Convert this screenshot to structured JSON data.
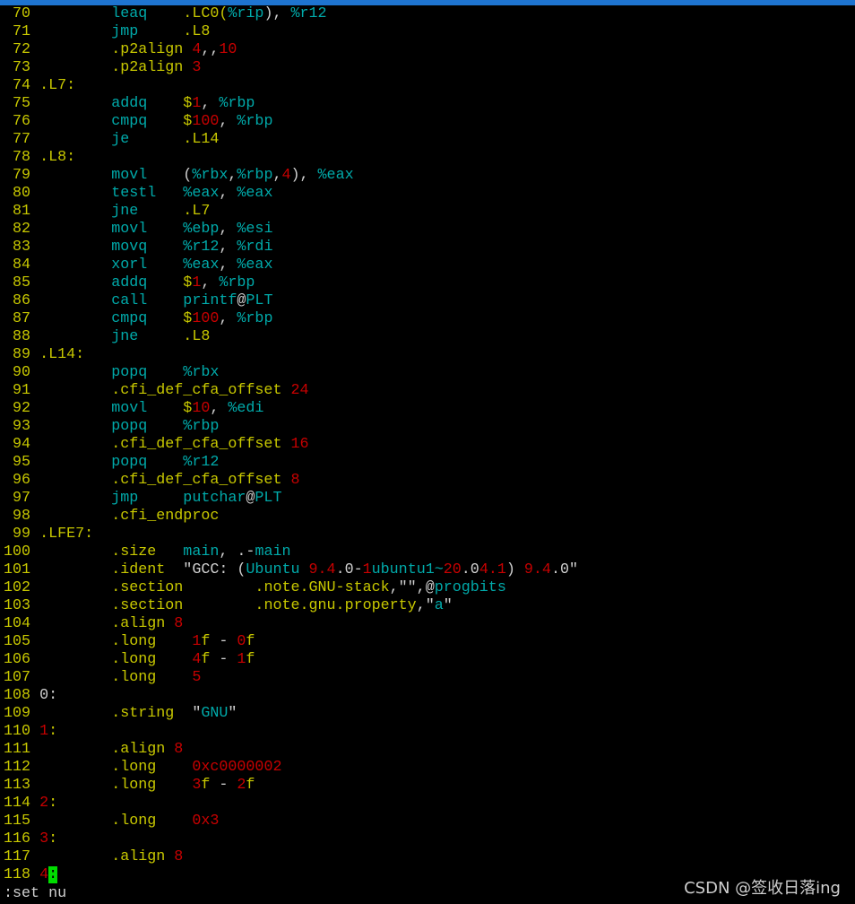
{
  "colors": {
    "line_number": "#c8c800",
    "label": "#c8c800",
    "mnemonic": "#00aaaa",
    "directive": "#c8c800",
    "number": "#c80000",
    "plain": "#d0d0d0",
    "cursor": "#00dd00",
    "title_bar": "#1e74d0"
  },
  "lines": [
    {
      "n": "70",
      "segs": [
        [
          "        ",
          "p"
        ],
        [
          "leaq",
          "k"
        ],
        [
          "    .LC0(",
          "d"
        ],
        [
          "%rip",
          "k"
        ],
        [
          "), ",
          "p"
        ],
        [
          "%r12",
          "k"
        ]
      ]
    },
    {
      "n": "71",
      "segs": [
        [
          "        ",
          "p"
        ],
        [
          "jmp",
          "k"
        ],
        [
          "     .L8",
          "d"
        ]
      ]
    },
    {
      "n": "72",
      "segs": [
        [
          "        ",
          "p"
        ],
        [
          ".p2align ",
          "d"
        ],
        [
          "4",
          "r"
        ],
        [
          ",,",
          "p"
        ],
        [
          "10",
          "r"
        ]
      ]
    },
    {
      "n": "73",
      "segs": [
        [
          "        ",
          "p"
        ],
        [
          ".p2align ",
          "d"
        ],
        [
          "3",
          "r"
        ]
      ]
    },
    {
      "n": "74",
      "segs": [
        [
          ".L7:",
          "L"
        ]
      ]
    },
    {
      "n": "75",
      "segs": [
        [
          "        ",
          "p"
        ],
        [
          "addq",
          "k"
        ],
        [
          "    $",
          "d"
        ],
        [
          "1",
          "r"
        ],
        [
          ", ",
          "p"
        ],
        [
          "%rbp",
          "k"
        ]
      ]
    },
    {
      "n": "76",
      "segs": [
        [
          "        ",
          "p"
        ],
        [
          "cmpq",
          "k"
        ],
        [
          "    $",
          "d"
        ],
        [
          "100",
          "r"
        ],
        [
          ", ",
          "p"
        ],
        [
          "%rbp",
          "k"
        ]
      ]
    },
    {
      "n": "77",
      "segs": [
        [
          "        ",
          "p"
        ],
        [
          "je",
          "k"
        ],
        [
          "      .L14",
          "d"
        ]
      ]
    },
    {
      "n": "78",
      "segs": [
        [
          ".L8:",
          "L"
        ]
      ]
    },
    {
      "n": "79",
      "segs": [
        [
          "        ",
          "p"
        ],
        [
          "movl",
          "k"
        ],
        [
          "    (",
          "p"
        ],
        [
          "%rbx",
          "k"
        ],
        [
          ",",
          "p"
        ],
        [
          "%rbp",
          "k"
        ],
        [
          ",",
          "p"
        ],
        [
          "4",
          "r"
        ],
        [
          "), ",
          "p"
        ],
        [
          "%eax",
          "k"
        ]
      ]
    },
    {
      "n": "80",
      "segs": [
        [
          "        ",
          "p"
        ],
        [
          "testl",
          "k"
        ],
        [
          "   %eax",
          "k"
        ],
        [
          ", ",
          "p"
        ],
        [
          "%eax",
          "k"
        ]
      ]
    },
    {
      "n": "81",
      "segs": [
        [
          "        ",
          "p"
        ],
        [
          "jne",
          "k"
        ],
        [
          "     .L7",
          "d"
        ]
      ]
    },
    {
      "n": "82",
      "segs": [
        [
          "        ",
          "p"
        ],
        [
          "movl",
          "k"
        ],
        [
          "    %ebp",
          "k"
        ],
        [
          ", ",
          "p"
        ],
        [
          "%esi",
          "k"
        ]
      ]
    },
    {
      "n": "83",
      "segs": [
        [
          "        ",
          "p"
        ],
        [
          "movq",
          "k"
        ],
        [
          "    %r12",
          "k"
        ],
        [
          ", ",
          "p"
        ],
        [
          "%rdi",
          "k"
        ]
      ]
    },
    {
      "n": "84",
      "segs": [
        [
          "        ",
          "p"
        ],
        [
          "xorl",
          "k"
        ],
        [
          "    %eax",
          "k"
        ],
        [
          ", ",
          "p"
        ],
        [
          "%eax",
          "k"
        ]
      ]
    },
    {
      "n": "85",
      "segs": [
        [
          "        ",
          "p"
        ],
        [
          "addq",
          "k"
        ],
        [
          "    $",
          "d"
        ],
        [
          "1",
          "r"
        ],
        [
          ", ",
          "p"
        ],
        [
          "%rbp",
          "k"
        ]
      ]
    },
    {
      "n": "86",
      "segs": [
        [
          "        ",
          "p"
        ],
        [
          "call",
          "k"
        ],
        [
          "    printf",
          "k"
        ],
        [
          "@",
          "p"
        ],
        [
          "PLT",
          "k"
        ]
      ]
    },
    {
      "n": "87",
      "segs": [
        [
          "        ",
          "p"
        ],
        [
          "cmpq",
          "k"
        ],
        [
          "    $",
          "d"
        ],
        [
          "100",
          "r"
        ],
        [
          ", ",
          "p"
        ],
        [
          "%rbp",
          "k"
        ]
      ]
    },
    {
      "n": "88",
      "segs": [
        [
          "        ",
          "p"
        ],
        [
          "jne",
          "k"
        ],
        [
          "     .L8",
          "d"
        ]
      ]
    },
    {
      "n": "89",
      "segs": [
        [
          ".L14:",
          "L"
        ]
      ]
    },
    {
      "n": "90",
      "segs": [
        [
          "        ",
          "p"
        ],
        [
          "popq",
          "k"
        ],
        [
          "    %rbx",
          "k"
        ]
      ]
    },
    {
      "n": "91",
      "segs": [
        [
          "        ",
          "p"
        ],
        [
          ".cfi_def_cfa_offset ",
          "d"
        ],
        [
          "24",
          "r"
        ]
      ]
    },
    {
      "n": "92",
      "segs": [
        [
          "        ",
          "p"
        ],
        [
          "movl",
          "k"
        ],
        [
          "    $",
          "d"
        ],
        [
          "10",
          "r"
        ],
        [
          ", ",
          "p"
        ],
        [
          "%edi",
          "k"
        ]
      ]
    },
    {
      "n": "93",
      "segs": [
        [
          "        ",
          "p"
        ],
        [
          "popq",
          "k"
        ],
        [
          "    %rbp",
          "k"
        ]
      ]
    },
    {
      "n": "94",
      "segs": [
        [
          "        ",
          "p"
        ],
        [
          ".cfi_def_cfa_offset ",
          "d"
        ],
        [
          "16",
          "r"
        ]
      ]
    },
    {
      "n": "95",
      "segs": [
        [
          "        ",
          "p"
        ],
        [
          "popq",
          "k"
        ],
        [
          "    %r12",
          "k"
        ]
      ]
    },
    {
      "n": "96",
      "segs": [
        [
          "        ",
          "p"
        ],
        [
          ".cfi_def_cfa_offset ",
          "d"
        ],
        [
          "8",
          "r"
        ]
      ]
    },
    {
      "n": "97",
      "segs": [
        [
          "        ",
          "p"
        ],
        [
          "jmp",
          "k"
        ],
        [
          "     putchar",
          "k"
        ],
        [
          "@",
          "p"
        ],
        [
          "PLT",
          "k"
        ]
      ]
    },
    {
      "n": "98",
      "segs": [
        [
          "        ",
          "p"
        ],
        [
          ".cfi_endproc",
          "d"
        ]
      ]
    },
    {
      "n": "99",
      "segs": [
        [
          ".LFE7:",
          "L"
        ]
      ]
    },
    {
      "n": "100",
      "segs": [
        [
          "        ",
          "p"
        ],
        [
          ".size",
          "d"
        ],
        [
          "   main",
          "k"
        ],
        [
          ", .-",
          "p"
        ],
        [
          "main",
          "k"
        ]
      ]
    },
    {
      "n": "101",
      "segs": [
        [
          "        ",
          "p"
        ],
        [
          ".ident",
          "d"
        ],
        [
          "  \"GCC: (",
          "p"
        ],
        [
          "Ubuntu ",
          "k"
        ],
        [
          "9.4",
          "r"
        ],
        [
          ".0-",
          "p"
        ],
        [
          "1",
          "r"
        ],
        [
          "ubuntu1~",
          "k"
        ],
        [
          "20",
          "r"
        ],
        [
          ".0",
          "p"
        ],
        [
          "4.1",
          "r"
        ],
        [
          ") ",
          "p"
        ],
        [
          "9.4",
          "r"
        ],
        [
          ".0\"",
          "p"
        ]
      ]
    },
    {
      "n": "102",
      "segs": [
        [
          "        ",
          "p"
        ],
        [
          ".section",
          "d"
        ],
        [
          "        .note.GNU-stack",
          "d"
        ],
        [
          ",\"\",@",
          "p"
        ],
        [
          "progbits",
          "k"
        ]
      ]
    },
    {
      "n": "103",
      "segs": [
        [
          "        ",
          "p"
        ],
        [
          ".section",
          "d"
        ],
        [
          "        .note.gnu.property",
          "d"
        ],
        [
          ",\"",
          "p"
        ],
        [
          "a",
          "k"
        ],
        [
          "\"",
          "p"
        ]
      ]
    },
    {
      "n": "104",
      "segs": [
        [
          "        ",
          "p"
        ],
        [
          ".align ",
          "d"
        ],
        [
          "8",
          "r"
        ]
      ]
    },
    {
      "n": "105",
      "segs": [
        [
          "        ",
          "p"
        ],
        [
          ".long",
          "d"
        ],
        [
          "    ",
          "p"
        ],
        [
          "1",
          "r"
        ],
        [
          "f",
          "d"
        ],
        [
          " - ",
          "p"
        ],
        [
          "0",
          "r"
        ],
        [
          "f",
          "d"
        ]
      ]
    },
    {
      "n": "106",
      "segs": [
        [
          "        ",
          "p"
        ],
        [
          ".long",
          "d"
        ],
        [
          "    ",
          "p"
        ],
        [
          "4",
          "r"
        ],
        [
          "f",
          "d"
        ],
        [
          " - ",
          "p"
        ],
        [
          "1",
          "r"
        ],
        [
          "f",
          "d"
        ]
      ]
    },
    {
      "n": "107",
      "segs": [
        [
          "        ",
          "p"
        ],
        [
          ".long",
          "d"
        ],
        [
          "    ",
          "p"
        ],
        [
          "5",
          "r"
        ]
      ]
    },
    {
      "n": "108",
      "segs": [
        [
          "0:",
          "p"
        ]
      ]
    },
    {
      "n": "109",
      "segs": [
        [
          "        ",
          "p"
        ],
        [
          ".string",
          "d"
        ],
        [
          "  \"",
          "p"
        ],
        [
          "GNU",
          "k"
        ],
        [
          "\"",
          "p"
        ]
      ]
    },
    {
      "n": "110",
      "segs": [
        [
          "1",
          "r"
        ],
        [
          ":",
          "d"
        ]
      ]
    },
    {
      "n": "111",
      "segs": [
        [
          "        ",
          "p"
        ],
        [
          ".align ",
          "d"
        ],
        [
          "8",
          "r"
        ]
      ]
    },
    {
      "n": "112",
      "segs": [
        [
          "        ",
          "p"
        ],
        [
          ".long",
          "d"
        ],
        [
          "    ",
          "p"
        ],
        [
          "0xc0000002",
          "r"
        ]
      ]
    },
    {
      "n": "113",
      "segs": [
        [
          "        ",
          "p"
        ],
        [
          ".long",
          "d"
        ],
        [
          "    ",
          "p"
        ],
        [
          "3",
          "r"
        ],
        [
          "f",
          "d"
        ],
        [
          " - ",
          "p"
        ],
        [
          "2",
          "r"
        ],
        [
          "f",
          "d"
        ]
      ]
    },
    {
      "n": "114",
      "segs": [
        [
          "2",
          "r"
        ],
        [
          ":",
          "d"
        ]
      ]
    },
    {
      "n": "115",
      "segs": [
        [
          "        ",
          "p"
        ],
        [
          ".long",
          "d"
        ],
        [
          "    ",
          "p"
        ],
        [
          "0x3",
          "r"
        ]
      ]
    },
    {
      "n": "116",
      "segs": [
        [
          "3",
          "r"
        ],
        [
          ":",
          "d"
        ]
      ]
    },
    {
      "n": "117",
      "segs": [
        [
          "        ",
          "p"
        ],
        [
          ".align ",
          "d"
        ],
        [
          "8",
          "r"
        ]
      ]
    },
    {
      "n": "118",
      "segs": [
        [
          "4",
          "r"
        ],
        [
          ":",
          "cur"
        ]
      ]
    }
  ],
  "command_line": ":set nu",
  "watermark": "CSDN @签收日落ing"
}
